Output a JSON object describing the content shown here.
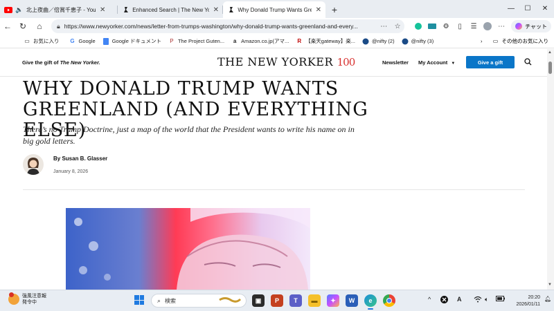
{
  "browser": {
    "tabs": [
      {
        "label": "北上夜曲／倍賞千恵子 - YouTube",
        "icon": "youtube-icon",
        "audio": true
      },
      {
        "label": "Enhanced Search | The New Yorker",
        "icon": "newyorker-icon"
      },
      {
        "label": "Why Donald Trump Wants Greenland",
        "icon": "newyorker-icon",
        "active": true
      }
    ],
    "new_tab": "+",
    "window_controls": {
      "minimize": "—",
      "maximize": "☐",
      "close": "✕"
    },
    "url": "https://www.newyorker.com/news/letter-from-trumps-washington/why-donald-trump-wants-greenland-and-every...",
    "copilot_label": "チャット",
    "bookmarks": [
      {
        "label": "お気に入り",
        "icon": "folder-icon"
      },
      {
        "label": "Google",
        "icon": "google-icon"
      },
      {
        "label": "Google ドキュメント",
        "icon": "docs-icon"
      },
      {
        "label": "The Project Guten...",
        "icon": "gutenberg-icon"
      },
      {
        "label": "Amazon.co.jp(アマ...",
        "icon": "amazon-icon"
      },
      {
        "label": "【楽天gateway】楽...",
        "icon": "rakuten-icon"
      },
      {
        "label": "@nifty (2)",
        "icon": "nifty-icon"
      },
      {
        "label": "@nifty (3)",
        "icon": "nifty-icon"
      }
    ],
    "other_bookmarks": "その他のお気に入り"
  },
  "site": {
    "gift_prefix": "Give the gift of",
    "gift_brand": "The New Yorker.",
    "logo_text": "THE NEW YORKER",
    "logo_100": "100",
    "newsletter": "Newsletter",
    "my_account": "My Account",
    "give_gift_button": "Give a gift"
  },
  "article": {
    "headline": "WHY DONALD TRUMP WANTS GREENLAND (AND EVERYTHING ELSE)",
    "dek": "There’s no Trump Doctrine, just a map of the world that the President wants to write his name on in big gold letters.",
    "byline": "By Susan B. Glasser",
    "date": "January 8, 2026"
  },
  "taskbar": {
    "weather_title": "強風注意報",
    "weather_sub": "発令中",
    "search_placeholder": "検索",
    "time": "20:20",
    "date": "2026/01/11"
  },
  "colors": {
    "accent_blue": "#0a76c8",
    "logo_red": "#d8312f"
  }
}
